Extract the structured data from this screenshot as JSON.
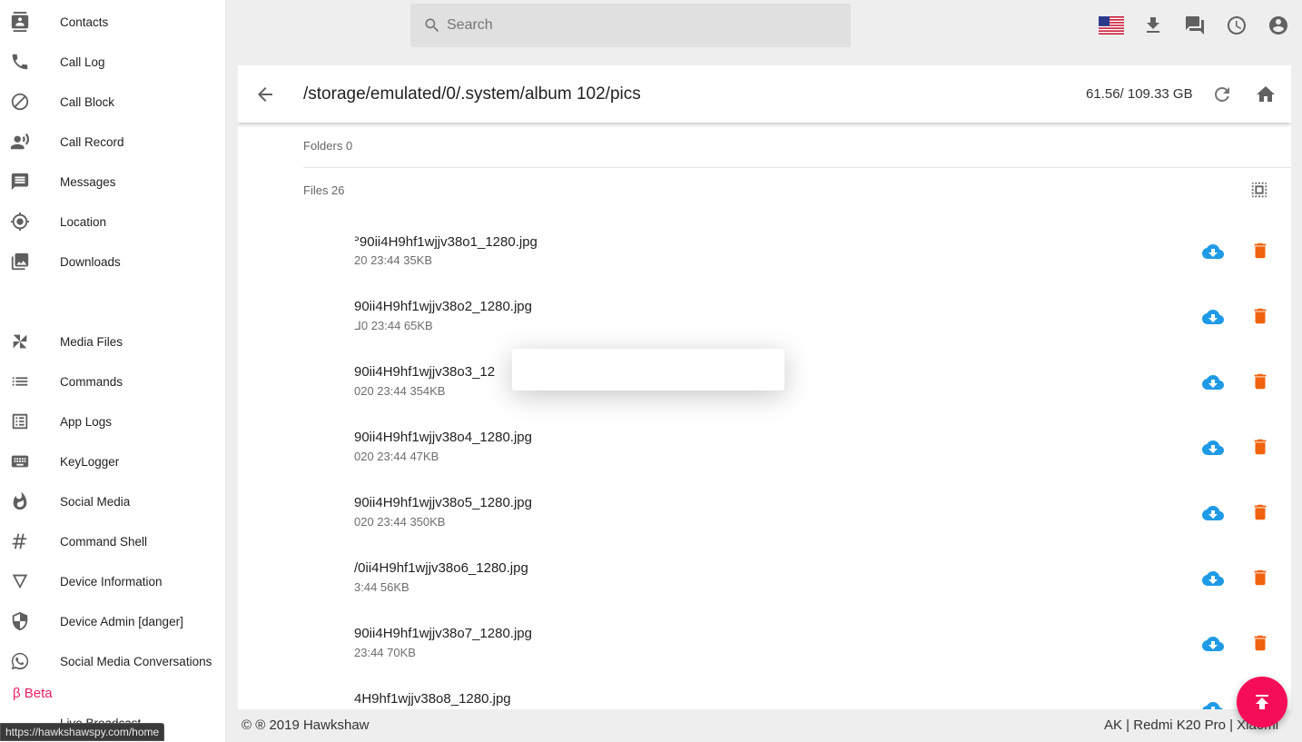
{
  "sidebar": {
    "items": [
      {
        "label": "Contacts",
        "icon": "contacts-icon"
      },
      {
        "label": "Call Log",
        "icon": "phone-icon"
      },
      {
        "label": "Call Block",
        "icon": "block-icon"
      },
      {
        "label": "Call Record",
        "icon": "record-voice-icon"
      },
      {
        "label": "Messages",
        "icon": "message-icon"
      },
      {
        "label": "Location",
        "icon": "location-icon"
      },
      {
        "label": "Downloads",
        "icon": "photo-library-icon"
      },
      {
        "label": "Media Files",
        "icon": "pinwheel-icon"
      },
      {
        "label": "Commands",
        "icon": "list-icon"
      },
      {
        "label": "App Logs",
        "icon": "list-alt-icon"
      },
      {
        "label": "KeyLogger",
        "icon": "keyboard-icon"
      },
      {
        "label": "Social Media",
        "icon": "flame-icon"
      },
      {
        "label": "Command Shell",
        "icon": "hash-icon"
      },
      {
        "label": "Device Information",
        "icon": "triangle-icon"
      },
      {
        "label": "Device Admin [danger]",
        "icon": "shield-icon"
      },
      {
        "label": "Social Media Conversations",
        "icon": "whatsapp-icon"
      }
    ],
    "beta_label": "β Beta",
    "live_label": "Live Broadcast"
  },
  "status_url": "https://hawkshawspy.com/home",
  "search": {
    "placeholder": "Search"
  },
  "topbar": {
    "icons": [
      "us-flag-icon",
      "download-icon",
      "forum-icon",
      "history-icon",
      "account-icon"
    ]
  },
  "header": {
    "path": "/storage/emulated/0/.system/album 102/pics",
    "storage": "61.56/ 109.33 GB"
  },
  "folders_label": "Folders 0",
  "files_label": "Files 26",
  "files": [
    {
      "name": "ᐣ90ii4H9hf1wjjv38o1_1280.jpg",
      "meta": "20 23:44 35KB"
    },
    {
      "name": "90ii4H9hf1wjjv38o2_1280.jpg",
      "meta": "ᒧ0 23:44 65KB"
    },
    {
      "name": "90ii4H9hf1wjjv38o3_12",
      "meta": "020 23:44 354KB"
    },
    {
      "name": "90ii4H9hf1wjjv38o4_1280.jpg",
      "meta": "020 23:44 47KB"
    },
    {
      "name": "90ii4H9hf1wjjv38o5_1280.jpg",
      "meta": "020 23:44 350KB"
    },
    {
      "name": "/0ii4H9hf1wjjv38o6_1280.jpg",
      "meta": "3:44 56KB"
    },
    {
      "name": "90ii4H9hf1wjjv38o7_1280.jpg",
      "meta": "23:44 70KB"
    },
    {
      "name": "4H9hf1wjjv38o8_1280.jpg",
      "meta": ""
    }
  ],
  "colors": {
    "download": "#1e9ae6",
    "delete": "#f0620e",
    "fab": "#f50e57",
    "beta": "#e91e63"
  },
  "footer": {
    "left": "© ® 2019 Hawkshaw",
    "right": "AK | Redmi K20 Pro | Xiaomi"
  }
}
